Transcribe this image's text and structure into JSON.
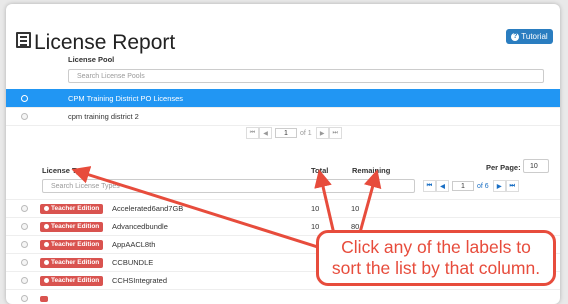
{
  "header": {
    "title": "License Report",
    "tutorial_label": "Tutorial"
  },
  "pool": {
    "column_header": "License Pool",
    "search_placeholder": "Search License Pools",
    "items": [
      {
        "name": "CPM Training District PO Licenses",
        "selected": true
      },
      {
        "name": "cpm training district 2",
        "selected": false
      }
    ],
    "pager": {
      "page": "1",
      "of_label": "of 1"
    }
  },
  "types": {
    "col_type": "License Type",
    "col_total": "Total",
    "col_remaining": "Remaining",
    "per_page_label": "Per Page:",
    "per_page_value": "10",
    "search_placeholder": "Search License Types",
    "pager": {
      "page": "1",
      "of_label": "of 6"
    },
    "badge_label": "Teacher Edition",
    "rows": [
      {
        "name": "Accelerated6and7GB",
        "total": "10",
        "remaining": "10"
      },
      {
        "name": "Advancedbundle",
        "total": "10",
        "remaining": "80"
      },
      {
        "name": "AppAACL8th",
        "total": "",
        "remaining": ""
      },
      {
        "name": "CCBUNDLE",
        "total": "",
        "remaining": ""
      },
      {
        "name": "CCHSIntegrated",
        "total": "",
        "remaining": ""
      }
    ]
  },
  "callout": {
    "text": "Click any of the labels to sort the list by that column."
  },
  "colors": {
    "accent": "#2196f3",
    "badge": "#d9534f",
    "annotation": "#e74c3c"
  }
}
